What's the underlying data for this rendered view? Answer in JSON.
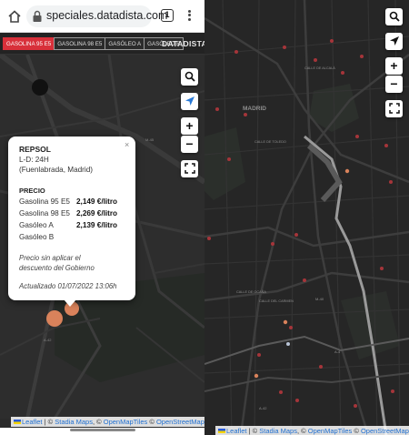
{
  "browser": {
    "url": "speciales.datadista.com",
    "tab_count": "1"
  },
  "fuel_tabs": [
    {
      "label": "GASOLINA 95 E5",
      "active": true
    },
    {
      "label": "GASOLINA 98 E5",
      "active": false
    },
    {
      "label": "GASÓLEO A",
      "active": false
    },
    {
      "label": "GASÓLEO B",
      "active": false
    }
  ],
  "brand": "DATADISTA",
  "map_controls": {
    "zoom_in": "+",
    "zoom_out": "−"
  },
  "popup": {
    "close": "×",
    "name": "REPSOL",
    "hours": "L-D: 24H",
    "location": "(Fuenlabrada, Madrid)",
    "price_header": "PRECIO",
    "prices": [
      {
        "fuel": "Gasolina 95 E5",
        "price": "2,149 €/litro"
      },
      {
        "fuel": "Gasolina 98 E5",
        "price": "2,269 €/litro"
      },
      {
        "fuel": "Gasóleo A",
        "price": "2,139 €/litro"
      },
      {
        "fuel": "Gasóleo B",
        "price": ""
      }
    ],
    "note_1": "Precio sin aplicar el",
    "note_2": "descuento del Gobierno",
    "updated": "Actualizado 01/07/2022 13:06h"
  },
  "attribution": {
    "leaflet": "Leaflet",
    "sep": " | © ",
    "stadia": "Stadia Maps",
    "sep2": ", © ",
    "omt": "OpenMapTiles",
    "sep3": " © ",
    "osm": "OpenStreetMap"
  },
  "map_labels": {
    "madrid": "MADRID",
    "calle_toledo": "CALLE DE TOLEDO",
    "calle_ocana": "CALLE DE OCAÑA",
    "calle_carmen": "CALLE DEL CARMEN",
    "calle_alcala": "CALLE DE ALCALÁ",
    "a4": "A-4",
    "a42": "A-42",
    "m40": "M-40",
    "m45": "M-45"
  },
  "colors": {
    "accent_red": "#d8303a",
    "marker_orange": "#d9825b",
    "map_dark": "#2a2a2a",
    "locate_blue": "#2a7ad6"
  }
}
